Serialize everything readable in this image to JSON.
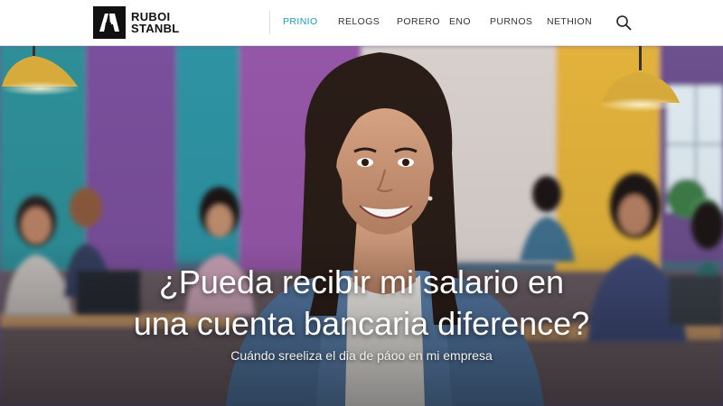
{
  "header": {
    "logo": {
      "line1": "RUBOI",
      "line2": "STANBL",
      "icon": "brand-logo-icon"
    },
    "nav": [
      {
        "label": "PRINIO",
        "active": true
      },
      {
        "label": "RELOGS",
        "active": false
      },
      {
        "label": "PORERO",
        "active": false
      },
      {
        "label": "ENO",
        "active": false
      },
      {
        "label": "PURNOS",
        "active": false
      },
      {
        "label": "NETHION",
        "active": false
      }
    ],
    "search_icon": "search-icon"
  },
  "hero": {
    "headline_line1": "¿Pueda recibir mi salario en",
    "headline_line2": "una cuenta bancaria diference?",
    "subline": "Cuándo sreeliza el dia de páoo en mi empresa"
  },
  "colors": {
    "accent": "#1b9ab7",
    "teal_wall": "#2f8f99",
    "purple_wall": "#7a4f9c",
    "yellow_wall": "#e2b23a",
    "denim": "#5f86b3"
  }
}
